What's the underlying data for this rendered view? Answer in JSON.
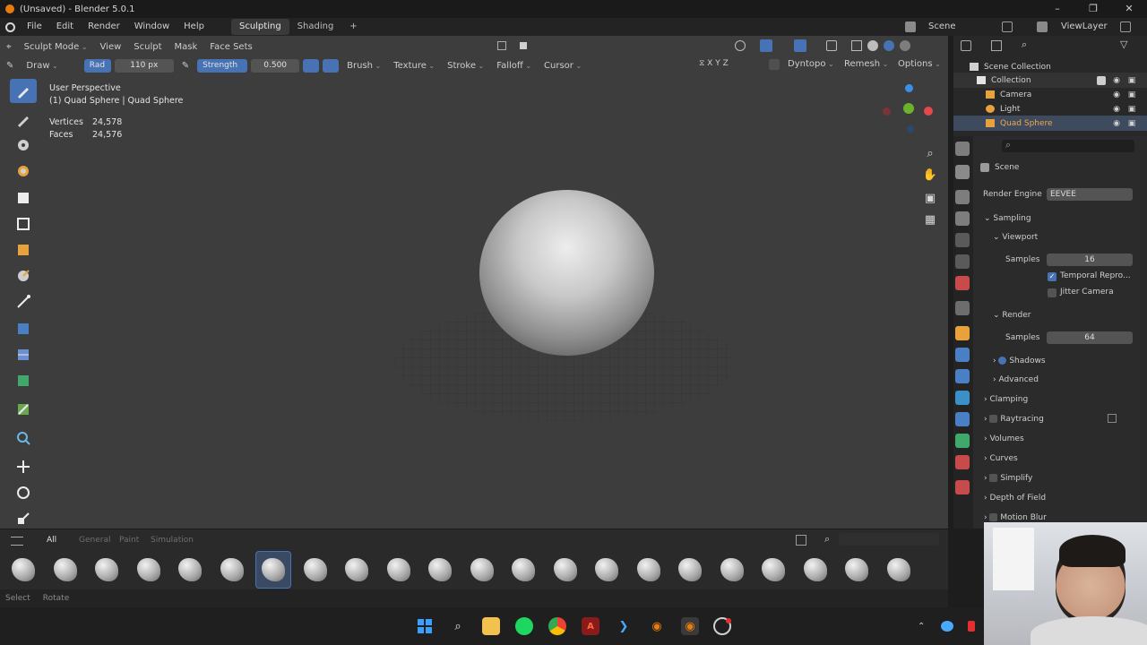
{
  "window": {
    "title": "(Unsaved) - Blender 5.0.1",
    "controls": {
      "minimize": "–",
      "maximize": "❐",
      "close": "✕"
    }
  },
  "menubar": {
    "items": [
      "File",
      "Edit",
      "Render",
      "Window",
      "Help"
    ],
    "workspaces": [
      "Sculpting",
      "Shading",
      "+"
    ],
    "active_workspace": "Sculpting",
    "scene": "Scene",
    "view_layer": "ViewLayer"
  },
  "viewport_header": {
    "mode": "Sculpt Mode",
    "menus": [
      "View",
      "Sculpt",
      "Mask",
      "Face Sets"
    ]
  },
  "tool_header": {
    "tool": "Draw",
    "radius_label": "Rad",
    "radius_value": "110 px",
    "strength_label": "Strength",
    "strength_value": "0.500",
    "menus": [
      "Brush",
      "Texture",
      "Stroke",
      "Falloff",
      "Cursor"
    ],
    "right_menus": [
      "Dyntopo",
      "Remesh",
      "Options"
    ]
  },
  "overlay": {
    "view_name": "User Perspective",
    "object_line": "(1) Quad Sphere | Quad Sphere",
    "stats": [
      {
        "label": "Vertices",
        "value": "24,578"
      },
      {
        "label": "Faces",
        "value": "24,576"
      }
    ]
  },
  "asset_shelf": {
    "tabs": [
      "All",
      "General",
      "Paint",
      "Simulation"
    ],
    "active_tab": "All",
    "selected_index": 6
  },
  "status_bar": {
    "items": [
      "Select",
      "Rotate"
    ]
  },
  "outliner": {
    "root": "Scene Collection",
    "collection": "Collection",
    "objects": [
      "Camera",
      "Light",
      "Quad Sphere"
    ],
    "active_object": "Quad Sphere"
  },
  "properties": {
    "breadcrumb": "Scene",
    "render_engine_label": "Render Engine",
    "render_engine_value": "EEVEE",
    "sections": {
      "sampling": "Sampling",
      "viewport": "Viewport",
      "viewport_samples_label": "Samples",
      "viewport_samples_value": "16",
      "temporal_reprojection": "Temporal Repro...",
      "jitter_camera": "Jitter Camera",
      "render": "Render",
      "render_samples_label": "Samples",
      "render_samples_value": "64",
      "shadows": "Shadows",
      "advanced": "Advanced",
      "clamping": "Clamping",
      "raytracing": "Raytracing",
      "volumes": "Volumes",
      "curves": "Curves",
      "simplify": "Simplify",
      "depth_of_field": "Depth of Field",
      "motion_blur": "Motion Blur"
    }
  },
  "colors": {
    "accent_blue": "#4772b3",
    "viewport_bg": "#3d3d3d",
    "panel_bg": "#2b2b2b",
    "gizmo_x": "#e8474d",
    "gizmo_y": "#6cb22b",
    "gizmo_z": "#3b8fe6"
  }
}
